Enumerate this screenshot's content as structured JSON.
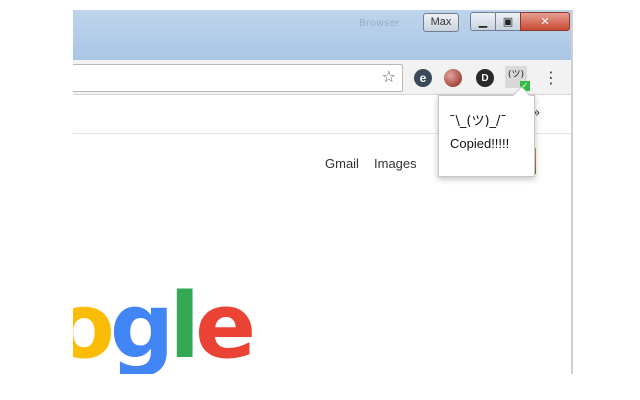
{
  "titlebar": {
    "ghost_text": "Browser",
    "user_badge": "Max",
    "minimize_glyph": "▁",
    "maximize_glyph": "▣",
    "close_glyph": "✕"
  },
  "toolbar": {
    "bookmark_star": "☆",
    "extensions": [
      {
        "name": "e-icon",
        "glyph": "e"
      },
      {
        "name": "ball-icon",
        "glyph": ""
      },
      {
        "name": "id-icon",
        "glyph": "D"
      },
      {
        "name": "shrug-icon",
        "glyph": "(ツ)"
      }
    ],
    "check_glyph": "✓",
    "menu_glyph": "⋮"
  },
  "bookmarks_bar": {
    "overflow_glyph": "»"
  },
  "page": {
    "gmail": "Gmail",
    "images": "Images",
    "logo": [
      {
        "char": "o",
        "color": "#FBBC05"
      },
      {
        "char": "g",
        "color": "#4285F4"
      },
      {
        "char": "l",
        "color": "#34A853"
      },
      {
        "char": "e",
        "color": "#EA4335"
      }
    ]
  },
  "popup": {
    "face": "¯\\_(ツ)_/¯",
    "message": "Copied!!!!!"
  }
}
